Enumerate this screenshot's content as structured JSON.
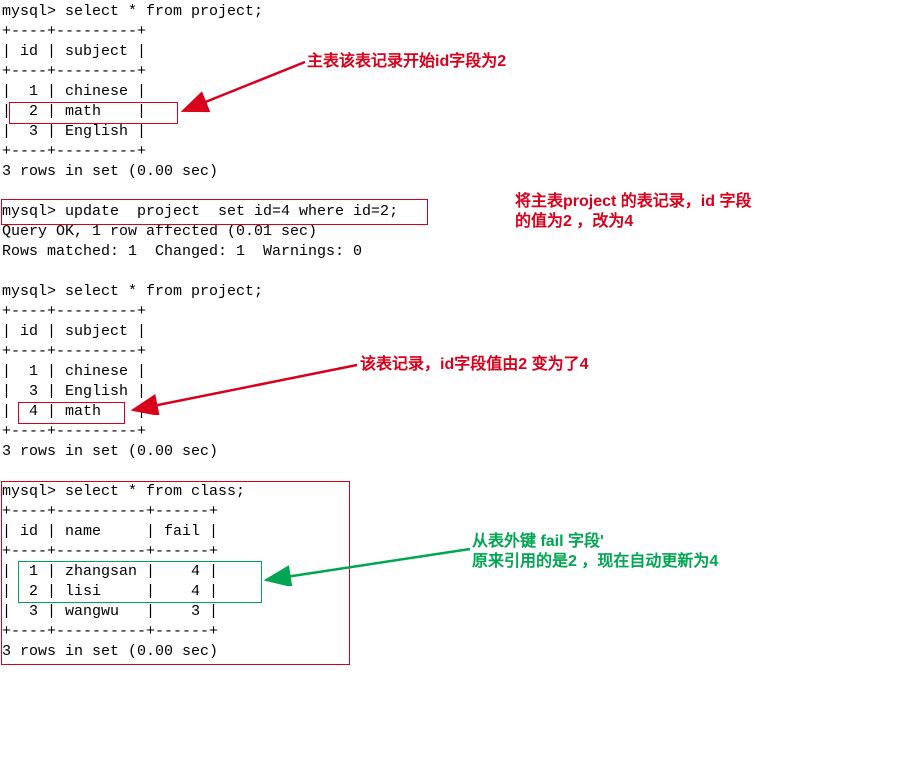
{
  "block1": {
    "prompt": "mysql> select * from project;",
    "border": "+----+---------+",
    "header": "| id | subject |",
    "rows": [
      "|  1 | chinese |",
      "|  2 | math    |",
      "|  3 | English |"
    ],
    "footer": "3 rows in set (0.00 sec)"
  },
  "annotation1": "主表该表记录开始id字段为2",
  "block2": {
    "prompt": "mysql> update  project  set id=4 where id=2;",
    "line1": "Query OK, 1 row affected (0.01 sec)",
    "line2": "Rows matched: 1  Changed: 1  Warnings: 0"
  },
  "annotation2_l1": "将主表project 的表记录，id 字段",
  "annotation2_l2": "的值为2 ，改为4",
  "block3": {
    "prompt": "mysql> select * from project;",
    "border": "+----+---------+",
    "header": "| id | subject |",
    "rows": [
      "|  1 | chinese |",
      "|  3 | English |",
      "|  4 | math    |"
    ],
    "footer": "3 rows in set (0.00 sec)"
  },
  "annotation3": "该表记录，id字段值由2 变为了4",
  "block4": {
    "prompt": "mysql> select * from class;",
    "border": "+----+----------+------+",
    "header": "| id | name     | fail |",
    "rows": [
      "|  1 | zhangsan |    4 |",
      "|  2 | lisi     |    4 |",
      "|  3 | wangwu   |    3 |"
    ],
    "footer": "3 rows in set (0.00 sec)"
  },
  "annotation4_l1": "从表外键 fail 字段'",
  "annotation4_l2": "原来引用的是2 ，现在自动更新为4"
}
